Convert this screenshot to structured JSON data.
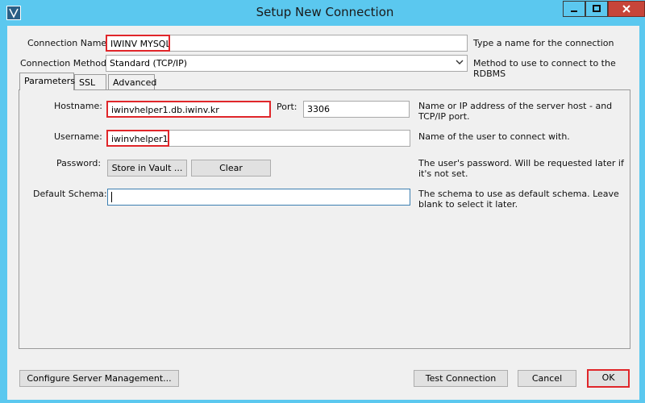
{
  "window": {
    "title": "Setup New Connection"
  },
  "form": {
    "connection_name": {
      "label": "Connection Name:",
      "value": "IWINV MYSQL",
      "desc": "Type a name for the connection"
    },
    "connection_method": {
      "label": "Connection Method:",
      "value": "Standard (TCP/IP)",
      "desc": "Method to use to connect to the RDBMS"
    }
  },
  "tabs": [
    "Parameters",
    "SSL",
    "Advanced"
  ],
  "params": {
    "hostname": {
      "label": "Hostname:",
      "value": "iwinvhelper1.db.iwinv.kr",
      "desc": "Name or IP address of the server host - and TCP/IP port."
    },
    "port": {
      "label": "Port:",
      "value": "3306"
    },
    "username": {
      "label": "Username:",
      "value": "iwinvhelper1",
      "desc": "Name of the user to connect with."
    },
    "password": {
      "label": "Password:",
      "store_label": "Store in Vault ...",
      "clear_label": "Clear",
      "desc": "The user's password. Will be requested later if it's not set."
    },
    "schema": {
      "label": "Default Schema:",
      "value": "",
      "desc": "The schema to use as default schema. Leave blank to select it later."
    }
  },
  "buttons": {
    "configure": "Configure Server Management...",
    "test": "Test Connection",
    "cancel": "Cancel",
    "ok": "OK"
  },
  "colors": {
    "titlebar": "#5bc8ef",
    "highlight": "#e0262a",
    "close": "#c7453a"
  }
}
